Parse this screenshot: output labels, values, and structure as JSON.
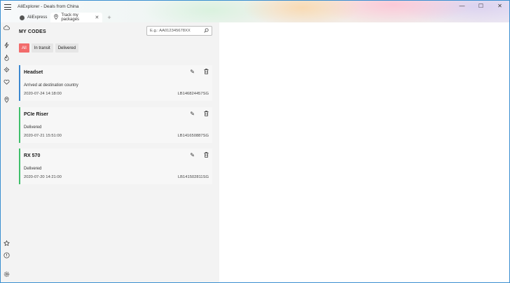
{
  "window": {
    "title": "AliExplorer - Deals from China",
    "controls": {
      "minimize": "—",
      "maximize": "☐",
      "close": "✕"
    }
  },
  "tabs": [
    {
      "label": "AliExpress",
      "icon": "globe-icon"
    },
    {
      "label": "Track my packages",
      "icon": "map-pin-icon",
      "close": "✕"
    }
  ],
  "tab_add": "+",
  "rail": {
    "icons": [
      "cloud-icon",
      "lightning-icon",
      "flame-icon",
      "shield-icon",
      "heart-icon",
      "location-icon",
      "star-icon",
      "info-icon",
      "settings-icon"
    ]
  },
  "panel": {
    "title": "MY CODES",
    "search": {
      "placeholder": "E.g.: AA012345678XX"
    },
    "filters": [
      {
        "label": "All",
        "active": true
      },
      {
        "label": "In transit",
        "active": false
      },
      {
        "label": "Delivered",
        "active": false
      }
    ],
    "packages": [
      {
        "name": "Headset",
        "status": "Arrived at destination country",
        "date": "2020-07-24 14:18:00",
        "code": "LB146824457SG",
        "accent": "#3b87cf"
      },
      {
        "name": "PCIe Riser",
        "status": "Delivered",
        "date": "2020-07-21 15:51:00",
        "code": "LB141650887SG",
        "accent": "#3fbf6a"
      },
      {
        "name": "RX 570",
        "status": "Delivered",
        "date": "2020-07-20 14:21:00",
        "code": "LB141502811SG",
        "accent": "#3fbf6a"
      }
    ]
  },
  "colors": {
    "filter_active": "#f26b6b",
    "in_transit": "#3b87cf",
    "delivered": "#3fbf6a",
    "window_border": "#3a8fd1"
  }
}
